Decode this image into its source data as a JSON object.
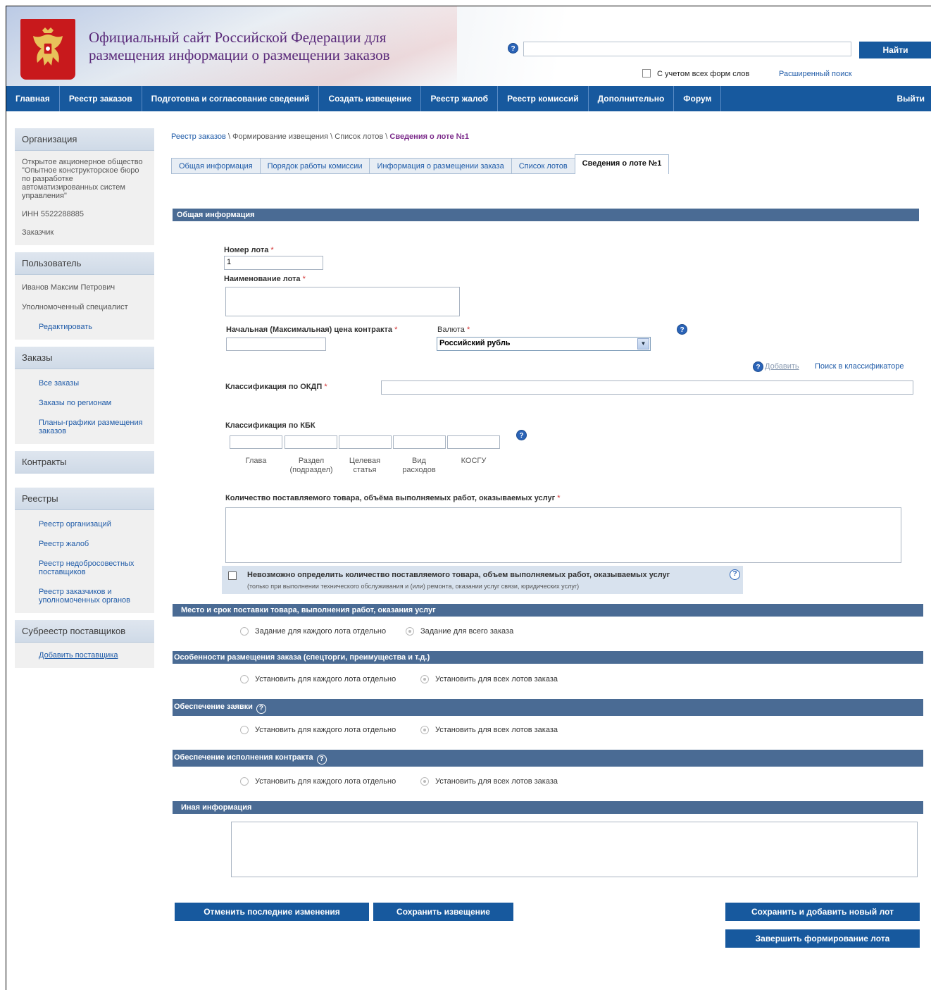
{
  "header": {
    "title_line1": "Официальный сайт Российской Федерации для",
    "title_line2": "размещения информации о размещении заказов",
    "search_button": "Найти",
    "word_forms_label": "С учетом всех форм слов",
    "advanced_search": "Расширенный поиск"
  },
  "nav": {
    "items": [
      "Главная",
      "Реестр заказов",
      "Подготовка и согласование сведений",
      "Создать извещение",
      "Реестр жалоб",
      "Реестр комиссий",
      "Дополнительно",
      "Форум"
    ],
    "exit": "Выйти"
  },
  "sidebar": {
    "org_head": "Организация",
    "org_name": "Открытое акционерное общество \"Опытное конструкторское бюро по разработке автоматизированных систем управления\"",
    "inn": "ИНН 5522288885",
    "role": "Заказчик",
    "user_head": "Пользователь",
    "user_name": "Иванов Максим Петрович",
    "user_role": "Уполномоченный специалист",
    "edit": "Редактировать",
    "orders_head": "Заказы",
    "orders_links": [
      "Все заказы",
      "Заказы по регионам",
      "Планы-графики размещения заказов"
    ],
    "contracts_head": "Контракты",
    "registries_head": "Реестры",
    "registries_links": [
      "Реестр организаций",
      "Реестр жалоб",
      "Реестр недобросовестных поставщиков",
      "Реестр заказчиков и уполномоченных органов"
    ],
    "subreg_head": "Субреестр поставщиков",
    "add_supplier": "Добавить поставщика"
  },
  "breadcrumb": {
    "part1": "Реестр заказов",
    "part2": " \\ Формирование извещения \\ Список лотов \\ ",
    "current": "Сведения о лоте №1"
  },
  "tabs": [
    "Общая информация",
    "Порядок работы комиссии",
    "Информация о размещении заказа",
    "Список лотов"
  ],
  "active_tab": "Сведения о лоте №1",
  "form": {
    "section_general": "Общая информация",
    "lot_number_label": "Номер лота",
    "lot_number_value": "1",
    "lot_name_label": "Наименование лота",
    "price_label": "Начальная (Максимальная) цена контракта",
    "currency_label": "Валюта",
    "currency_value": "Российский рубль",
    "add_link": "Добавить",
    "classifier_search": "Поиск в классификаторе",
    "okdp_label": "Классификация по ОКДП",
    "kbk_label": "Классификация по КБК",
    "kbk_cols": [
      "Глава",
      "Раздел (подраздел)",
      "Целевая статья",
      "Вид расходов",
      "КОСГУ"
    ],
    "qty_label": "Количество поставляемого товара, объёма выполняемых работ, оказываемых услуг",
    "qty_undetermined": "Невозможно определить количество поставляемого товара, объем выполняемых работ, оказываемых услуг",
    "qty_note": "(только при выполнении технического обслуживания и (или) ремонта, оказании услуг связи, юридических услуг)",
    "section_place": "Место и срок поставки товара, выполнения работ, оказания услуг",
    "place_opt1": "Задание для каждого лота отдельно",
    "place_opt2": "Задание для всего заказа",
    "section_features": "Особенности размещения заказа (спецторги, преимущества и т.д.)",
    "set_each": "Установить для каждого лота отдельно",
    "set_all": "Установить для всех лотов заказа",
    "section_bid_security": "Обеспечение заявки",
    "section_contract_security": "Обеспечение исполнения контракта",
    "section_other": "Иная информация"
  },
  "buttons": {
    "cancel": "Отменить последние изменения",
    "save_notice": "Сохранить извещение",
    "save_add_lot": "Сохранить и добавить новый лот",
    "finish_lot": "Завершить формирование лота"
  },
  "colors": {
    "nav_blue": "#17599e",
    "section_bar": "#4a6b94",
    "link": "#1f5ba8"
  }
}
